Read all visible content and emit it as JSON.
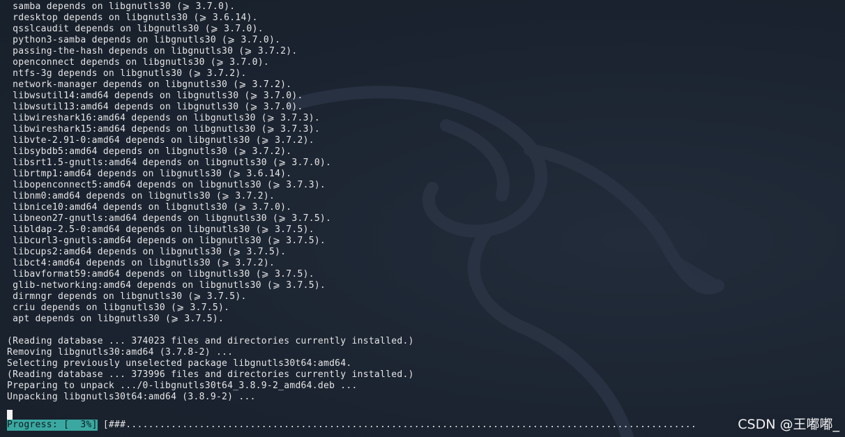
{
  "terminal": {
    "lines": [
      " samba depends on libgnutls30 (⩾ 3.7.0).",
      " rdesktop depends on libgnutls30 (⩾ 3.6.14).",
      " qsslcaudit depends on libgnutls30 (⩾ 3.7.0).",
      " python3-samba depends on libgnutls30 (⩾ 3.7.0).",
      " passing-the-hash depends on libgnutls30 (⩾ 3.7.2).",
      " openconnect depends on libgnutls30 (⩾ 3.7.0).",
      " ntfs-3g depends on libgnutls30 (⩾ 3.7.2).",
      " network-manager depends on libgnutls30 (⩾ 3.7.2).",
      " libwsutil14:amd64 depends on libgnutls30 (⩾ 3.7.0).",
      " libwsutil13:amd64 depends on libgnutls30 (⩾ 3.7.0).",
      " libwireshark16:amd64 depends on libgnutls30 (⩾ 3.7.3).",
      " libwireshark15:amd64 depends on libgnutls30 (⩾ 3.7.3).",
      " libvte-2.91-0:amd64 depends on libgnutls30 (⩾ 3.7.2).",
      " libsybdb5:amd64 depends on libgnutls30 (⩾ 3.7.2).",
      " libsrt1.5-gnutls:amd64 depends on libgnutls30 (⩾ 3.7.0).",
      " librtmp1:amd64 depends on libgnutls30 (⩾ 3.6.14).",
      " libopenconnect5:amd64 depends on libgnutls30 (⩾ 3.7.3).",
      " libnm0:amd64 depends on libgnutls30 (⩾ 3.7.2).",
      " libnice10:amd64 depends on libgnutls30 (⩾ 3.7.0).",
      " libneon27-gnutls:amd64 depends on libgnutls30 (⩾ 3.7.5).",
      " libldap-2.5-0:amd64 depends on libgnutls30 (⩾ 3.7.5).",
      " libcurl3-gnutls:amd64 depends on libgnutls30 (⩾ 3.7.5).",
      " libcups2:amd64 depends on libgnutls30 (⩾ 3.7.5).",
      " libct4:amd64 depends on libgnutls30 (⩾ 3.7.2).",
      " libavformat59:amd64 depends on libgnutls30 (⩾ 3.7.5).",
      " glib-networking:amd64 depends on libgnutls30 (⩾ 3.7.5).",
      " dirmngr depends on libgnutls30 (⩾ 3.7.5).",
      " criu depends on libgnutls30 (⩾ 3.7.5).",
      " apt depends on libgnutls30 (⩾ 3.7.5).",
      "",
      "(Reading database ... 374023 files and directories currently installed.)",
      "Removing libgnutls30:amd64 (3.7.8-2) ...",
      "Selecting previously unselected package libgnutls30t64:amd64.",
      "(Reading database ... 373996 files and directories currently installed.)",
      "Preparing to unpack .../0-libgnutls30t64_3.8.9-2_amd64.deb ...",
      "Unpacking libgnutls30t64:amd64 (3.8.9-2) ..."
    ],
    "progress": {
      "label": "Progress: [  3%]",
      "bar_text": " [###.....................................................................................................",
      "percent": 3
    }
  },
  "watermark": "CSDN @王嘟嘟_",
  "colors": {
    "background": "#1c2430",
    "text": "#e6e6e6",
    "progress_highlight": "#3aa8a0"
  }
}
